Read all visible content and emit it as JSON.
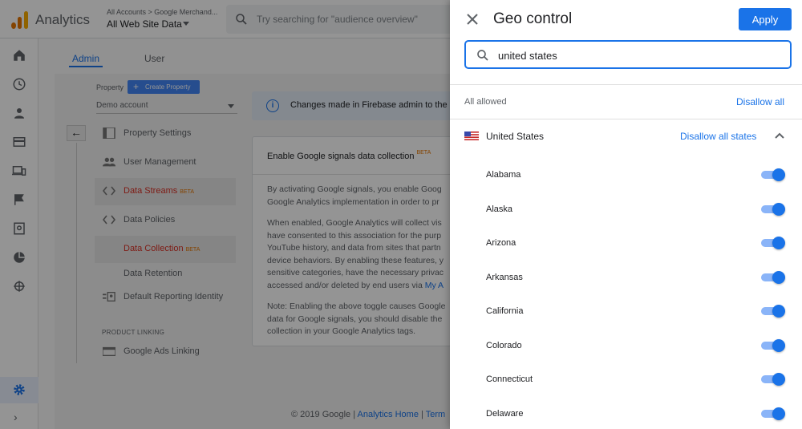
{
  "app": {
    "name": "Analytics",
    "account_path": "All Accounts > Google Merchand...",
    "view_name": "All Web Site Data",
    "search_placeholder": "Try searching for \"audience overview\""
  },
  "admin": {
    "tabs": [
      "Admin",
      "User"
    ],
    "property_label": "Property",
    "create_property": "Create Property",
    "property_select": "Demo account",
    "menu": [
      {
        "label": "Property Settings"
      },
      {
        "label": "User Management"
      },
      {
        "label": "Data Streams",
        "beta": "BETA"
      },
      {
        "label": "Data Policies"
      },
      {
        "label": "Data Collection",
        "beta": "BETA"
      },
      {
        "label": "Data Retention"
      },
      {
        "label": "Default Reporting Identity"
      }
    ],
    "product_linking_label": "PRODUCT LINKING",
    "product_linking_item": "Google Ads Linking"
  },
  "main": {
    "banner_text": "Changes made in Firebase admin to the",
    "card_title": "Enable Google signals data collection",
    "card_beta": "BETA",
    "para1": "By activating Google signals, you enable Goog\nGoogle Analytics implementation in order to pr",
    "para2_a": "When enabled, Google Analytics will collect vis\nhave consented to this association for the purp\nYouTube history, and data from sites that partn\ndevice behaviors. By enabling these features, y\nsensitive categories, have the necessary privac\naccessed and/or deleted by end users via ",
    "para2_link": "My A",
    "para3": "Note: Enabling the above toggle causes Google\ndata for Google signals, you should disable the\ncollection in your Google Analytics tags."
  },
  "footer": {
    "copyright": "© 2019 Google | ",
    "home_link": "Analytics Home",
    "sep": " | ",
    "terms_link": "Term"
  },
  "geo": {
    "title": "Geo control",
    "apply": "Apply",
    "search_value": "united states",
    "all_allowed": "All allowed",
    "disallow_all": "Disallow all",
    "country": "United States",
    "disallow_states": "Disallow all states",
    "states": [
      {
        "name": "Alabama",
        "allowed": true
      },
      {
        "name": "Alaska",
        "allowed": true
      },
      {
        "name": "Arizona",
        "allowed": true
      },
      {
        "name": "Arkansas",
        "allowed": true
      },
      {
        "name": "California",
        "allowed": true
      },
      {
        "name": "Colorado",
        "allowed": true
      },
      {
        "name": "Connecticut",
        "allowed": true
      },
      {
        "name": "Delaware",
        "allowed": true
      }
    ]
  },
  "colors": {
    "accent": "#1a73e8",
    "toggle_track": "#8ab4f8",
    "beta": "#e37400",
    "selected_text": "#d93025"
  }
}
